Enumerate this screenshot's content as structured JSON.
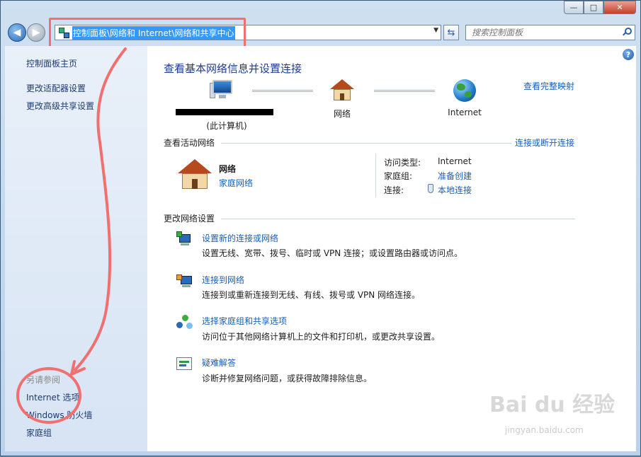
{
  "window": {
    "minimize_symbol": "—",
    "maximize_symbol": "□",
    "close_symbol": "✕"
  },
  "navbar": {
    "back_symbol": "◀",
    "forward_symbol": "▶",
    "address": "控制面板\\网络和 Internet\\网络和共享中心",
    "dropdown_symbol": "▼",
    "refresh_symbol": "⇆",
    "search_placeholder": "搜索控制面板"
  },
  "sidebar": {
    "items": [
      {
        "label": "控制面板主页"
      },
      {
        "label": "更改适配器设置"
      },
      {
        "label": "更改高级共享设置"
      }
    ],
    "see_also_label": "另请参阅",
    "see_also_items": [
      {
        "label": "Internet 选项"
      },
      {
        "label": "Windows 防火墙"
      },
      {
        "label": "家庭组"
      }
    ]
  },
  "main": {
    "help_symbol": "?",
    "title": "查看基本网络信息并设置连接",
    "full_map_link": "查看完整映射",
    "map": {
      "computer_label": "(此计算机)",
      "network_label": "网络",
      "internet_label": "Internet"
    },
    "active_networks": {
      "heading": "查看活动网络",
      "connect_link": "连接或断开连接",
      "network_name": "网络",
      "network_type": "家庭网络",
      "access_type_label": "访问类型:",
      "access_type_value": "Internet",
      "homegroup_label": "家庭组:",
      "homegroup_value": "准备创建",
      "connections_label": "连接:",
      "connections_value": "本地连接"
    },
    "change_settings": {
      "heading": "更改网络设置",
      "tasks": [
        {
          "title": "设置新的连接或网络",
          "desc": "设置无线、宽带、拨号、临时或 VPN 连接；或设置路由器或访问点。",
          "icon": "new-connection-icon"
        },
        {
          "title": "连接到网络",
          "desc": "连接到或重新连接到无线、有线、拨号或 VPN 网络连接。",
          "icon": "connect-network-icon"
        },
        {
          "title": "选择家庭组和共享选项",
          "desc": "访问位于其他网络计算机上的文件和打印机，或更改共享设置。",
          "icon": "homegroup-icon"
        },
        {
          "title": "疑难解答",
          "desc": "诊断并修复网络问题，或获得故障排除信息。",
          "icon": "troubleshoot-icon"
        }
      ]
    }
  },
  "watermark": {
    "brand": "Bai du 经验",
    "url": "jingyan.baidu.com"
  },
  "colors": {
    "link": "#1a5fb4",
    "title": "#1e3d8f",
    "annotation": "#f07070"
  }
}
